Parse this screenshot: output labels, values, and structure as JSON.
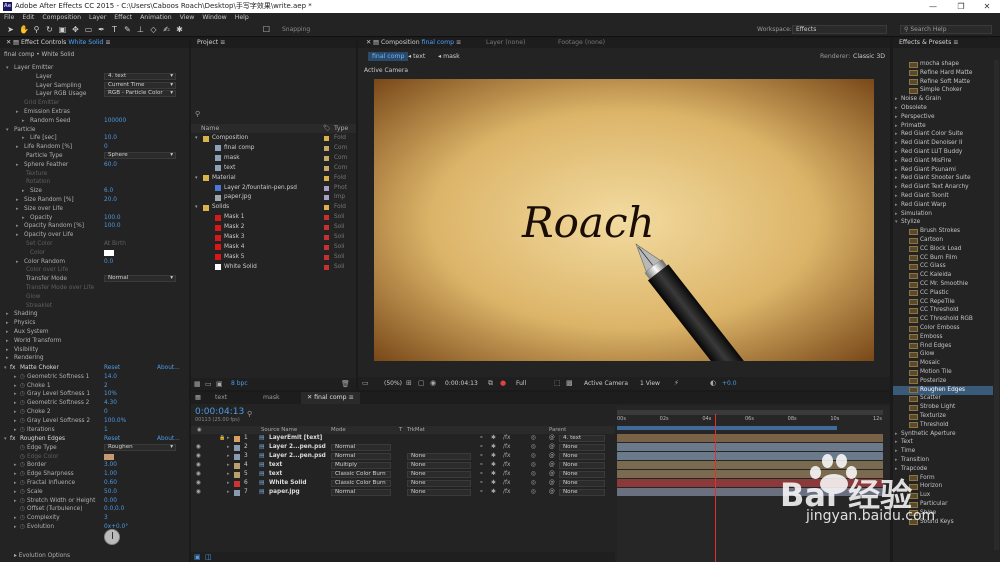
{
  "window": {
    "title": "Adobe After Effects CC 2015 - C:\\Users\\Caboos Roach\\Desktop\\手写字效果\\write.aep *",
    "app_badge": "Ae"
  },
  "menu": [
    "File",
    "Edit",
    "Composition",
    "Layer",
    "Effect",
    "Animation",
    "View",
    "Window",
    "Help"
  ],
  "toolbar": {
    "snapping": "Snapping",
    "workspace_label": "Workspace:",
    "workspace_value": "Effects",
    "search_placeholder": "Search Help"
  },
  "effect_controls": {
    "tab_prefix": "Effect Controls",
    "tab_layer": "White Solid",
    "breadcrumb": "final comp • White Solid",
    "rows": [
      {
        "t": "▾",
        "l": "Layer Emitter",
        "x": 14
      },
      {
        "l": "Layer",
        "v": "4. text",
        "sel": true,
        "x": 36
      },
      {
        "l": "Layer Sampling",
        "v": "Current Time",
        "sel": true,
        "x": 36
      },
      {
        "l": "Layer RGB Usage",
        "v": "RGB - Particle Color",
        "sel": true,
        "x": 36
      },
      {
        "l": "Grid Emitter",
        "x": 24,
        "dim": true
      },
      {
        "t": "▸",
        "l": "Emission Extras",
        "x": 24
      },
      {
        "t": "▸",
        "l": "Random Seed",
        "v": "100000",
        "x": 30
      },
      {
        "t": "▾",
        "l": "Particle",
        "x": 14
      },
      {
        "t": "▸",
        "l": "Life [sec]",
        "v": "10.0",
        "x": 30
      },
      {
        "t": "▸",
        "l": "Life Random [%]",
        "v": "0",
        "x": 24
      },
      {
        "l": "Particle Type",
        "v": "Sphere",
        "sel": true,
        "x": 26
      },
      {
        "t": "▸",
        "l": "Sphere Feather",
        "v": "60.0",
        "x": 24
      },
      {
        "l": "Texture",
        "x": 26,
        "dim": true
      },
      {
        "l": "Rotation",
        "x": 26,
        "dim": true
      },
      {
        "t": "▸",
        "l": "Size",
        "v": "6.0",
        "x": 30
      },
      {
        "t": "▸",
        "l": "Size Random [%]",
        "v": "20.0",
        "x": 24
      },
      {
        "t": "▸",
        "l": "Size over Life",
        "x": 24
      },
      {
        "t": "▸",
        "l": "Opacity",
        "v": "100.0",
        "x": 30
      },
      {
        "t": "▸",
        "l": "Opacity Random [%]",
        "v": "100.0",
        "x": 24
      },
      {
        "t": "▸",
        "l": "Opacity over Life",
        "x": 24
      },
      {
        "l": "Set Color",
        "v": "At Birth",
        "x": 26,
        "dim": true
      },
      {
        "l": "Color",
        "x": 30,
        "dim": true
      },
      {
        "t": "▸",
        "l": "Color Random",
        "v": "0.0",
        "x": 24
      },
      {
        "l": "Color over Life",
        "x": 26,
        "dim": true
      },
      {
        "l": "Transfer Mode",
        "v": "Normal",
        "sel": true,
        "x": 26
      },
      {
        "l": "Transfer Mode over Life",
        "x": 26,
        "dim": true
      },
      {
        "l": "Glow",
        "x": 26,
        "dim": true
      },
      {
        "l": "Streaklet",
        "x": 26,
        "dim": true
      },
      {
        "t": "▸",
        "l": "Shading",
        "x": 14
      },
      {
        "t": "▸",
        "l": "Physics",
        "x": 14
      },
      {
        "t": "▸",
        "l": "Aux System",
        "x": 14
      },
      {
        "t": "▸",
        "l": "World Transform",
        "x": 14
      },
      {
        "t": "▸",
        "l": "Visibility",
        "x": 14
      },
      {
        "t": "▸",
        "l": "Rendering",
        "x": 14
      }
    ],
    "matte_choker": {
      "name": "Matte Choker",
      "reset": "Reset",
      "about": "About...",
      "rows": [
        {
          "l": "Geometric Softness 1",
          "v": "14.0"
        },
        {
          "l": "Choke 1",
          "v": "2"
        },
        {
          "l": "Gray Level Softness 1",
          "v": "10%"
        },
        {
          "l": "Geometric Softness 2",
          "v": "4.30"
        },
        {
          "l": "Choke 2",
          "v": "0"
        },
        {
          "l": "Gray Level Softness 2",
          "v": "100.0%"
        },
        {
          "l": "Iterations",
          "v": "1"
        }
      ]
    },
    "roughen_edges": {
      "name": "Roughen Edges",
      "reset": "Reset",
      "about": "About...",
      "rows": [
        {
          "l": "Edge Type",
          "v": "Roughen",
          "sel": true,
          "tri": false
        },
        {
          "l": "Edge Color",
          "v": "",
          "dim": true,
          "tri": false
        },
        {
          "l": "Border",
          "v": "3.00",
          "tri": true
        },
        {
          "l": "Edge Sharpness",
          "v": "1.00",
          "tri": true
        },
        {
          "l": "Fractal Influence",
          "v": "0.60",
          "tri": true
        },
        {
          "l": "Scale",
          "v": "50.0",
          "tri": true
        },
        {
          "l": "Stretch Width or Height",
          "v": "0.00",
          "tri": true
        },
        {
          "l": "Offset (Turbulence)",
          "v": "0.0,0.0",
          "tri": false
        },
        {
          "l": "Complexity",
          "v": "3",
          "tri": true
        },
        {
          "l": "Evolution",
          "v": "0x+0.0°",
          "tri": true
        }
      ]
    },
    "evolution_options": "Evolution Options"
  },
  "project": {
    "tab": "Project",
    "columns": {
      "name": "Name",
      "type": "Type"
    },
    "items": [
      {
        "n": "Composition",
        "k": "folder",
        "indent": 0,
        "type": "Fold"
      },
      {
        "n": "final comp",
        "k": "comp",
        "indent": 1,
        "type": "Com"
      },
      {
        "n": "mask",
        "k": "comp",
        "indent": 1,
        "type": "Com"
      },
      {
        "n": "text",
        "k": "comp",
        "indent": 1,
        "type": "Com"
      },
      {
        "n": "Material",
        "k": "folder",
        "indent": 0,
        "type": "Fold"
      },
      {
        "n": "Layer 2/fountain-pen.psd",
        "k": "psd",
        "indent": 1,
        "type": "Phot"
      },
      {
        "n": "paper.jpg",
        "k": "img",
        "indent": 1,
        "type": "Imp"
      },
      {
        "n": "Solids",
        "k": "folder",
        "indent": 0,
        "type": "Fold"
      },
      {
        "n": "Mask 1",
        "k": "red",
        "indent": 1,
        "type": "Soli"
      },
      {
        "n": "Mask 2",
        "k": "red",
        "indent": 1,
        "type": "Soli"
      },
      {
        "n": "Mask 3",
        "k": "red",
        "indent": 1,
        "type": "Soli"
      },
      {
        "n": "Mask 4",
        "k": "red",
        "indent": 1,
        "type": "Soli"
      },
      {
        "n": "Mask 5",
        "k": "red",
        "indent": 1,
        "type": "Soli"
      },
      {
        "n": "White Solid",
        "k": "white",
        "indent": 1,
        "type": "Soli"
      }
    ],
    "bpc": "8 bpc"
  },
  "viewer": {
    "tab_prefix": "Composition",
    "tab_comp": "final comp",
    "tab_layer": "Layer (none)",
    "tab_footage": "Footage (none)",
    "crumbs": [
      "final comp",
      "text",
      "mask"
    ],
    "renderer_label": "Renderer:",
    "renderer_value": "Classic 3D",
    "active_camera": "Active Camera",
    "comp_text": "Roach",
    "footer": {
      "zoom": "(50%)",
      "time": "0:00:04:13",
      "quality": "Full",
      "view": "Active Camera",
      "views": "1 View",
      "exposure": "+0.0"
    }
  },
  "timeline": {
    "tabs": [
      "text",
      "mask",
      "final comp"
    ],
    "timecode": "0:00:04:13",
    "frames": "00113 (25.00 fps)",
    "columns": {
      "source": "Source Name",
      "mode": "Mode",
      "t": "T",
      "trkmat": "TrkMat",
      "parent": "Parent"
    },
    "layers": [
      {
        "n": "1",
        "name": "LayerEmit [text]",
        "mode": "",
        "trk": "",
        "parent": "4. text",
        "color": "#d8a060",
        "bar": "#7a6248"
      },
      {
        "n": "2",
        "name": "Layer 2...pen.psd",
        "mode": "Normal",
        "trk": "",
        "parent": "None",
        "color": "#8a9ab0",
        "bar": "#6b7a8a"
      },
      {
        "n": "3",
        "name": "Layer 2...pen.psd",
        "mode": "Normal",
        "trk": "None",
        "parent": "None",
        "color": "#8a9ab0",
        "bar": "#6b7a8a"
      },
      {
        "n": "4",
        "name": "text",
        "mode": "Multiply",
        "trk": "None",
        "parent": "None",
        "color": "#b8a070",
        "bar": "#7a6a50"
      },
      {
        "n": "5",
        "name": "text",
        "mode": "Classic Color Burn",
        "trk": "None",
        "parent": "None",
        "color": "#b8a070",
        "bar": "#7a6a50"
      },
      {
        "n": "6",
        "name": "White Solid",
        "mode": "Classic Color Burn",
        "trk": "None",
        "parent": "None",
        "color": "#c33",
        "bar": "#8a3a3a"
      },
      {
        "n": "7",
        "name": "paper.jpg",
        "mode": "Normal",
        "trk": "None",
        "parent": "None",
        "color": "#8a9ab0",
        "bar": "#6b7080"
      }
    ],
    "ruler": [
      "00s",
      "02s",
      "04s",
      "06s",
      "08s",
      "10s",
      "12s"
    ],
    "playhead_fraction": 0.37
  },
  "effects_presets": {
    "tab": "Effects & Presets",
    "items": [
      {
        "n": "mocha shape",
        "fx": true
      },
      {
        "n": "Refine Hard Matte",
        "fx": true
      },
      {
        "n": "Refine Soft Matte",
        "fx": true
      },
      {
        "n": "Simple Choker",
        "fx": true
      },
      {
        "n": "Noise & Grain",
        "g": true
      },
      {
        "n": "Obsolete",
        "g": true
      },
      {
        "n": "Perspective",
        "g": true
      },
      {
        "n": "Primatte",
        "g": true
      },
      {
        "n": "Red Giant Color Suite",
        "g": true
      },
      {
        "n": "Red Giant Denoiser II",
        "g": true
      },
      {
        "n": "Red Giant LUT Buddy",
        "g": true
      },
      {
        "n": "Red Giant MisFire",
        "g": true
      },
      {
        "n": "Red Giant Psunami",
        "g": true
      },
      {
        "n": "Red Giant Shooter Suite",
        "g": true
      },
      {
        "n": "Red Giant Text Anarchy",
        "g": true
      },
      {
        "n": "Red Giant ToonIt",
        "g": true
      },
      {
        "n": "Red Giant Warp",
        "g": true
      },
      {
        "n": "Simulation",
        "g": true
      },
      {
        "n": "Stylize",
        "g": true,
        "open": true
      },
      {
        "n": "Brush Strokes",
        "fx": true
      },
      {
        "n": "Cartoon",
        "fx": true
      },
      {
        "n": "CC Block Load",
        "fx": true
      },
      {
        "n": "CC Burn Film",
        "fx": true
      },
      {
        "n": "CC Glass",
        "fx": true
      },
      {
        "n": "CC Kaleida",
        "fx": true
      },
      {
        "n": "CC Mr. Smoothie",
        "fx": true
      },
      {
        "n": "CC Plastic",
        "fx": true
      },
      {
        "n": "CC RepeTile",
        "fx": true
      },
      {
        "n": "CC Threshold",
        "fx": true
      },
      {
        "n": "CC Threshold RGB",
        "fx": true
      },
      {
        "n": "Color Emboss",
        "fx": true
      },
      {
        "n": "Emboss",
        "fx": true
      },
      {
        "n": "Find Edges",
        "fx": true
      },
      {
        "n": "Glow",
        "fx": true
      },
      {
        "n": "Mosaic",
        "fx": true
      },
      {
        "n": "Motion Tile",
        "fx": true
      },
      {
        "n": "Posterize",
        "fx": true
      },
      {
        "n": "Roughen Edges",
        "fx": true,
        "sel": true
      },
      {
        "n": "Scatter",
        "fx": true
      },
      {
        "n": "Strobe Light",
        "fx": true
      },
      {
        "n": "Texturize",
        "fx": true
      },
      {
        "n": "Threshold",
        "fx": true
      },
      {
        "n": "Synthetic Aperture",
        "g": true
      },
      {
        "n": "Text",
        "g": true
      },
      {
        "n": "Time",
        "g": true
      },
      {
        "n": "Transition",
        "g": true
      },
      {
        "n": "Trapcode",
        "g": true
      },
      {
        "n": "Form",
        "fx": true
      },
      {
        "n": "Horizon",
        "fx": true
      },
      {
        "n": "Lux",
        "fx": true
      },
      {
        "n": "Particular",
        "fx": true
      },
      {
        "n": "Shine",
        "fx": true
      },
      {
        "n": "Sound Keys",
        "fx": true
      }
    ]
  },
  "watermark": {
    "text": "Bai 经验",
    "url": "jingyan.baidu.com"
  }
}
